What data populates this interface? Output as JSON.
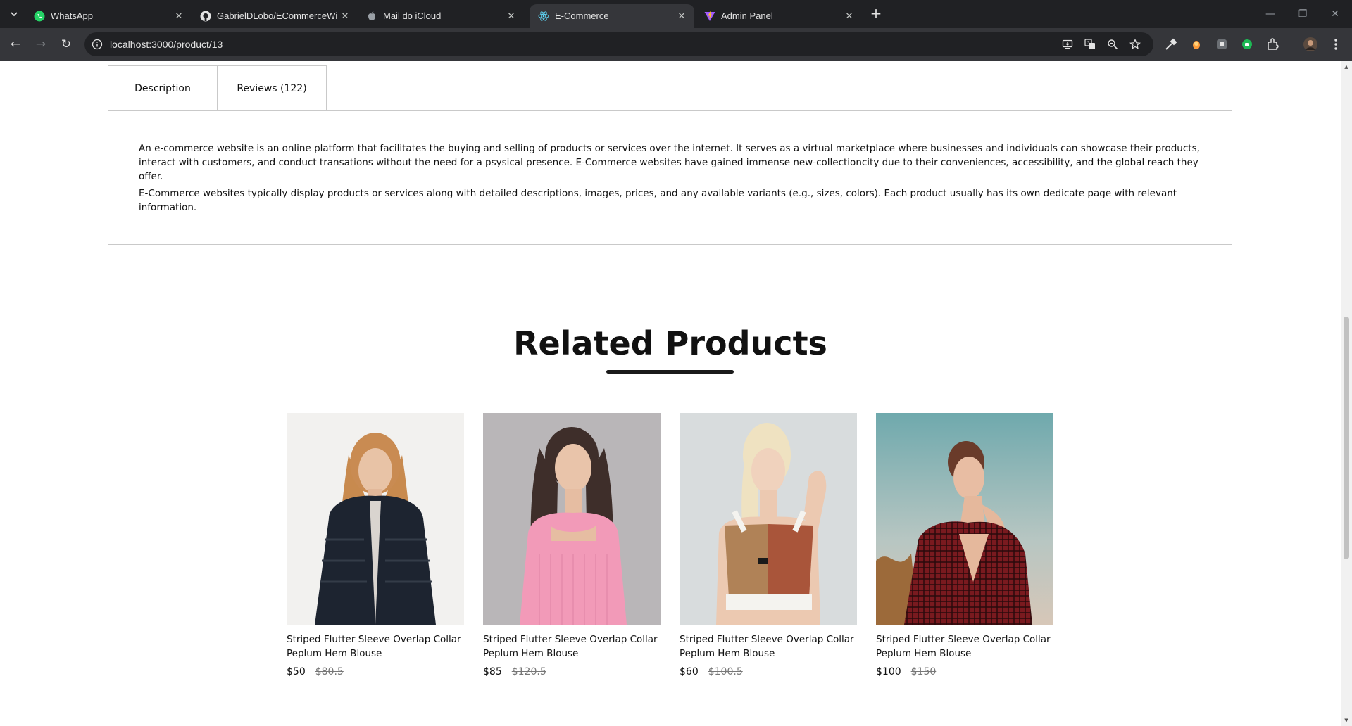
{
  "browser": {
    "tabs": [
      {
        "title": "WhatsApp",
        "icon": "whatsapp-icon",
        "active": false
      },
      {
        "title": "GabrielDLobo/ECommerceWith",
        "icon": "github-icon",
        "active": false
      },
      {
        "title": "Mail do iCloud",
        "icon": "apple-icon",
        "active": false
      },
      {
        "title": "E-Commerce",
        "icon": "react-icon",
        "active": true
      },
      {
        "title": "Admin Panel",
        "icon": "vite-icon",
        "active": false
      }
    ],
    "url": "localhost:3000/product/13"
  },
  "product_tabs": {
    "description_label": "Description",
    "reviews_label": "Reviews (122)"
  },
  "description": {
    "paragraph_1": "An e-commerce website is an online platform that facilitates the buying and selling of products or services over the internet. It serves as a virtual marketplace where businesses and individuals can showcase their products, interact with customers, and conduct transations without the need for a psysical presence. E-Commerce websites have gained immense new-collectioncity due to their conveniences, accessibility, and the global reach they offer.",
    "paragraph_2": "E-Commerce websites typically display products or services along with detailed descriptions, images, prices, and any available variants (e.g., sizes, colors). Each product usually has its own dedicate page with relevant information."
  },
  "related": {
    "title": "Related Products",
    "items": [
      {
        "name": "Striped Flutter Sleeve Overlap Collar Peplum Hem Blouse",
        "price": "$50",
        "old_price": "$80.5"
      },
      {
        "name": "Striped Flutter Sleeve Overlap Collar Peplum Hem Blouse",
        "price": "$85",
        "old_price": "$120.5"
      },
      {
        "name": "Striped Flutter Sleeve Overlap Collar Peplum Hem Blouse",
        "price": "$60",
        "old_price": "$100.5"
      },
      {
        "name": "Striped Flutter Sleeve Overlap Collar Peplum Hem Blouse",
        "price": "$100",
        "old_price": "$150"
      }
    ]
  }
}
